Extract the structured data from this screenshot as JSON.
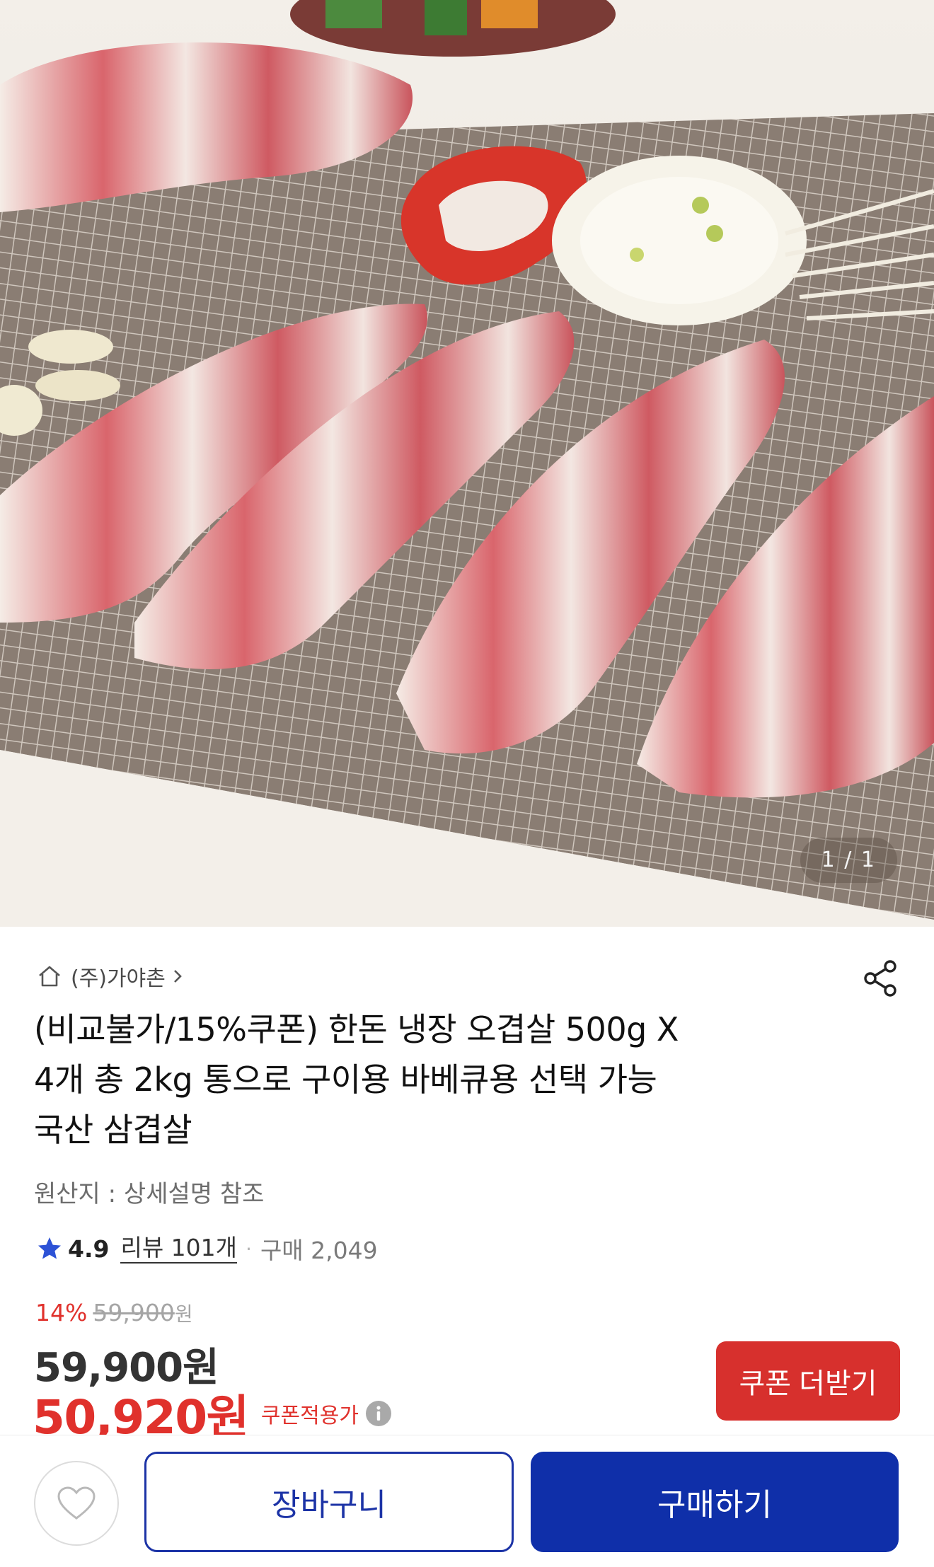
{
  "gallery": {
    "counter": "1 / 1"
  },
  "seller": {
    "name": "(주)가야촌"
  },
  "product": {
    "title_lines": [
      "(비교불가/15%쿠폰) 한돈 냉장 오겹살 500g X",
      "4개 총 2kg 통으로 구이용 바베큐용 선택 가능",
      "국산 삼겹살"
    ],
    "origin": "원산지 : 상세설명 참조"
  },
  "rating": {
    "score": "4.9",
    "review_label": "리뷰 101개",
    "separator": "·",
    "purchase_label": "구매 2,049"
  },
  "pricing": {
    "discount_rate": "14%",
    "original_price": "59,900",
    "original_unit": "원",
    "price": "59,900원",
    "coupon_price": "50,920원",
    "coupon_label": "쿠폰적용가"
  },
  "buttons": {
    "coupon": "쿠폰 더받기",
    "cart": "장바구니",
    "buy": "구매하기"
  },
  "colors": {
    "accent_red": "#e0312c",
    "coupon_button": "#d7302d",
    "primary_blue": "#0f2fa9",
    "star": "#2d52d6"
  },
  "icons": {
    "home": "home-icon",
    "chevron": "chevron-right-icon",
    "share": "share-icon",
    "star": "star-icon",
    "info": "info-icon",
    "heart": "heart-icon"
  }
}
